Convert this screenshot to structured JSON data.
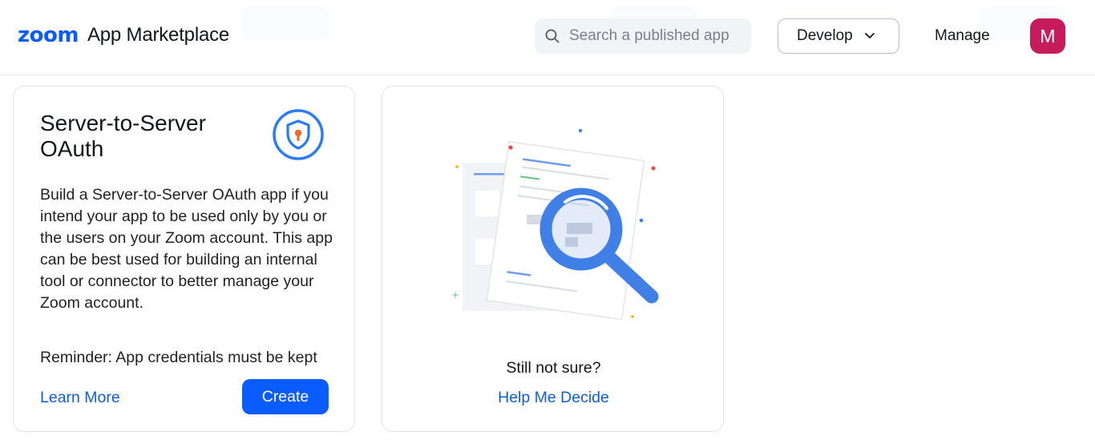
{
  "header": {
    "logo_brand": "zoom",
    "logo_text": "App Marketplace",
    "search_placeholder": "Search a published app",
    "develop_label": "Develop",
    "manage_label": "Manage",
    "avatar_initial": "M"
  },
  "colors": {
    "brand_blue": "#0b5cff",
    "avatar_bg": "#c61c5b",
    "link_blue": "#0e5fd8"
  },
  "card_s2s": {
    "title": "Server-to-Server OAuth",
    "icon": "shield-lock-icon",
    "description": "Build a Server-to-Server OAuth app if you intend your app to be used only by you or the users on your Zoom account. This app can be best used for building an internal tool or connector to better manage your Zoom account.",
    "reminder": "Reminder: App credentials must be kept",
    "learn_more": "Learn More",
    "create": "Create"
  },
  "card_help": {
    "illustration": "document-magnifier-illustration",
    "prompt": "Still not sure?",
    "link": "Help Me Decide"
  }
}
